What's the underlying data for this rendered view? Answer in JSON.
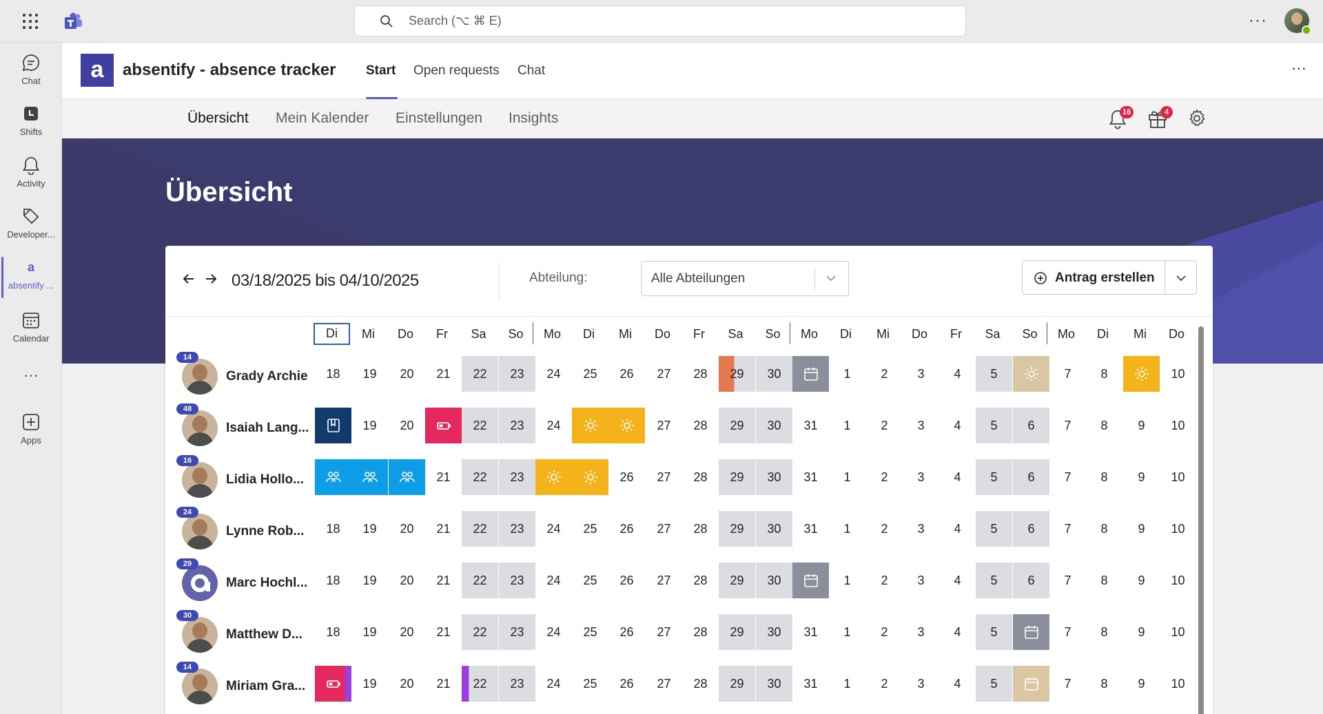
{
  "search": {
    "placeholder": "Search (⌥ ⌘ E)"
  },
  "rail": [
    {
      "label": "Chat",
      "icon": "chat-icon"
    },
    {
      "label": "Shifts",
      "icon": "shifts-icon"
    },
    {
      "label": "Activity",
      "icon": "bell-icon"
    },
    {
      "label": "Developer...",
      "icon": "developer-icon"
    },
    {
      "label": "absentify ...",
      "icon": "absentify-icon"
    },
    {
      "label": "Calendar",
      "icon": "calendar-icon"
    },
    {
      "label": "Apps",
      "icon": "plus-square-icon"
    }
  ],
  "app": {
    "logo_letter": "a",
    "title": "absentify - absence tracker",
    "tabs": [
      "Start",
      "Open requests",
      "Chat"
    ],
    "active_tab": "Start"
  },
  "subnav": {
    "tabs": [
      "Übersicht",
      "Mein Kalender",
      "Einstellungen",
      "Insights"
    ],
    "active": "Übersicht",
    "notifications_count": "16",
    "gifts_count": "4"
  },
  "banner": {
    "title": "Übersicht"
  },
  "toolbar": {
    "date_range": "03/18/2025 bis 04/10/2025",
    "department_label": "Abteilung:",
    "department_value": "Alle Abteilungen",
    "create_label": "Antrag erstellen"
  },
  "colors": {
    "brand": "#3f3fa0",
    "accent": "#5b5fc7",
    "weekend": "#dcdde2",
    "holiday": "#8b8e9b",
    "vacation": "#f5b31b",
    "team": "#0e9ee8",
    "sick": "#e5285d"
  },
  "days": [
    {
      "d": "Di",
      "n": "18"
    },
    {
      "d": "Mi",
      "n": "19"
    },
    {
      "d": "Do",
      "n": "20"
    },
    {
      "d": "Fr",
      "n": "21"
    },
    {
      "d": "Sa",
      "n": "22"
    },
    {
      "d": "So",
      "n": "23"
    },
    {
      "d": "Mo",
      "n": "24"
    },
    {
      "d": "Di",
      "n": "25"
    },
    {
      "d": "Mi",
      "n": "26"
    },
    {
      "d": "Do",
      "n": "27"
    },
    {
      "d": "Fr",
      "n": "28"
    },
    {
      "d": "Sa",
      "n": "29"
    },
    {
      "d": "So",
      "n": "30"
    },
    {
      "d": "Mo",
      "n": "31"
    },
    {
      "d": "Di",
      "n": "1"
    },
    {
      "d": "Mi",
      "n": "2"
    },
    {
      "d": "Do",
      "n": "3"
    },
    {
      "d": "Fr",
      "n": "4"
    },
    {
      "d": "Sa",
      "n": "5"
    },
    {
      "d": "So",
      "n": "6"
    },
    {
      "d": "Mo",
      "n": "7"
    },
    {
      "d": "Di",
      "n": "8"
    },
    {
      "d": "Mi",
      "n": "9"
    },
    {
      "d": "Do",
      "n": "10"
    }
  ],
  "people": [
    {
      "name": "Grady Archie",
      "count": "14",
      "cells": {
        "11": "orange-half",
        "13": "holiday-icon",
        "18": "weekend",
        "19": "holiday-tan-sun",
        "22": "vacation-sun"
      }
    },
    {
      "name": "Isaiah Lang...",
      "count": "48",
      "cells": {
        "0": "navy-book",
        "3": "sick-battery",
        "7": "vacation-sun",
        "8": "vacation-sun"
      }
    },
    {
      "name": "Lidia Hollo...",
      "count": "16",
      "cells": {
        "0": "team-people",
        "1": "team-people",
        "2": "team-people",
        "6": "vacation-sun",
        "7": "vacation-sun"
      }
    },
    {
      "name": "Lynne Rob...",
      "count": "24",
      "cells": {}
    },
    {
      "name": "Marc Hochl...",
      "count": "29",
      "cells": {
        "13": "holiday-icon"
      }
    },
    {
      "name": "Matthew D...",
      "count": "30",
      "cells": {
        "19": "holiday-icon"
      }
    },
    {
      "name": "Miriam Gra...",
      "count": "14",
      "cells": {
        "0": "sick-battery-purple",
        "4": "purple-half",
        "19": "holiday-tan-icon"
      }
    }
  ]
}
